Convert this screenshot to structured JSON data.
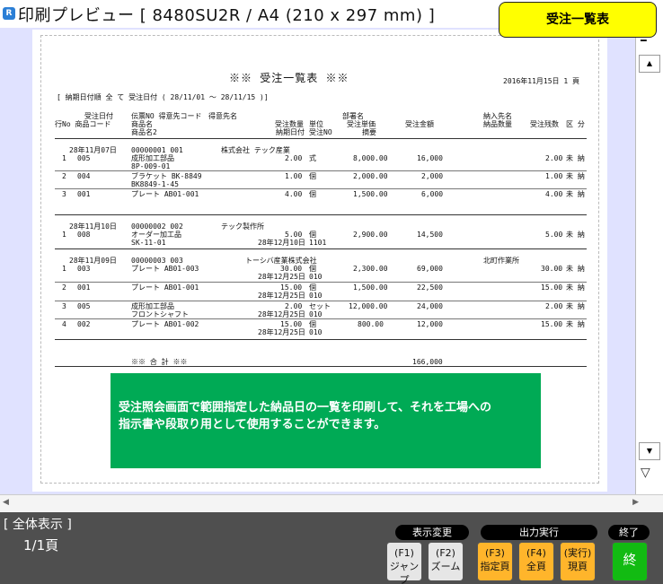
{
  "window": {
    "title": "印刷プレビュー [ 8480SU2R / A4 (210 x 297 mm) ]",
    "badge": "受注一覧表"
  },
  "report": {
    "title": "※※ 受注一覧表 ※※",
    "date_page": "2016年11月15日  1 頁",
    "criteria": "[ 納期日付順 全 て    受注日付 ( 28/11/01 ～  28/11/15 )]",
    "headers": {
      "row1": [
        "受注日付",
        "伝票NO 得意先コード",
        "得意先名",
        "部署名",
        "納入先名"
      ],
      "row2": [
        "行No 商品コード",
        "商品名",
        "受注数量",
        "単位",
        "受注単価",
        "受注金額",
        "納品数量",
        "受注残数",
        "区 分"
      ],
      "row3": [
        "商品名2",
        "納期日付",
        "受注NO",
        "摘要"
      ]
    },
    "orders": [
      {
        "date": "28年11月07日",
        "slip": "00000001 001",
        "customer": "株式会社 テック産業",
        "dept": "",
        "delivery_to": "",
        "lines": [
          {
            "no": "1",
            "code": "005",
            "name": "成形加工部品",
            "name2": "8P-009-01",
            "qty": "2.00",
            "unit": "式",
            "due": "",
            "order_no": "",
            "price": "8,000.00",
            "amount": "16,000",
            "remain": "2.00",
            "status": "未 納"
          },
          {
            "no": "2",
            "code": "004",
            "name": "ブラケット BK-8849",
            "name2": "BK8849-1-45",
            "qty": "1.00",
            "unit": "個",
            "due": "",
            "order_no": "",
            "price": "2,000.00",
            "amount": "2,000",
            "remain": "1.00",
            "status": "未 納"
          },
          {
            "no": "3",
            "code": "001",
            "name": "プレート AB01-001",
            "name2": "",
            "qty": "4.00",
            "unit": "個",
            "due": "",
            "order_no": "",
            "price": "1,500.00",
            "amount": "6,000",
            "remain": "4.00",
            "status": "未 納"
          }
        ]
      },
      {
        "date": "28年11月10日",
        "slip": "00000002 002",
        "customer": "テック製作所",
        "dept": "",
        "delivery_to": "",
        "lines": [
          {
            "no": "1",
            "code": "008",
            "name": "オーダー加工品",
            "name2": "SK-11-01",
            "qty": "5.00",
            "unit": "個",
            "due": "28年12月10日",
            "order_no": "1101",
            "price": "2,900.00",
            "amount": "14,500",
            "remain": "5.00",
            "status": "未 納"
          }
        ]
      },
      {
        "date": "28年11月09日",
        "slip": "00000003 003",
        "customer": "トーシバ産業株式会社",
        "dept": "",
        "delivery_to": "北町作業所",
        "lines": [
          {
            "no": "1",
            "code": "003",
            "name": "プレート AB01-003",
            "name2": "",
            "qty": "30.00",
            "unit": "個",
            "due": "28年12月25日",
            "order_no": "010",
            "price": "2,300.00",
            "amount": "69,000",
            "remain": "30.00",
            "status": "未 納"
          },
          {
            "no": "2",
            "code": "001",
            "name": "プレート AB01-001",
            "name2": "",
            "qty": "15.00",
            "unit": "個",
            "due": "28年12月25日",
            "order_no": "010",
            "price": "1,500.00",
            "amount": "22,500",
            "remain": "15.00",
            "status": "未 納"
          },
          {
            "no": "3",
            "code": "005",
            "name": "成形加工部品",
            "name2": "フロントシャフト",
            "qty": "2.00",
            "unit": "セット",
            "due": "28年12月25日",
            "order_no": "010",
            "price": "12,000.00",
            "amount": "24,000",
            "remain": "2.00",
            "status": "未 納"
          },
          {
            "no": "4",
            "code": "002",
            "name": "プレート AB01-002",
            "name2": "",
            "qty": "15.00",
            "unit": "個",
            "due": "28年12月25日",
            "order_no": "010",
            "price": "800.00",
            "amount": "12,000",
            "remain": "15.00",
            "status": "未 納"
          }
        ]
      }
    ],
    "total_label": "※※ 合  計 ※※",
    "total_amount": "166,000"
  },
  "note": {
    "line1": "受注照会画面で範囲指定した納品日の一覧を印刷して、それを工場への",
    "line2": "指示書や段取り用として使用することができます。"
  },
  "status": {
    "view_mode": "[ 全体表示  ]",
    "page": "1/1頁",
    "groups": {
      "display": "表示変更",
      "output": "出力実行",
      "exit": "終了"
    },
    "keys": {
      "f1": {
        "top": "(F1)",
        "bottom": "ジャンプ"
      },
      "f2": {
        "top": "(F2)",
        "bottom": "ズーム"
      },
      "f3": {
        "top": "(F3)",
        "bottom": "指定頁"
      },
      "f4": {
        "top": "(F4)",
        "bottom": "全頁"
      },
      "exec": {
        "top": "(実行)",
        "bottom": "現頁"
      },
      "end": "終"
    }
  },
  "colors": {
    "canvas": "#e0e2ff",
    "badge": "#ffff00",
    "note": "#00aa55",
    "status_bar": "#4f4f4f",
    "key_orange": "#ffb52b",
    "key_green": "#12bb12"
  }
}
